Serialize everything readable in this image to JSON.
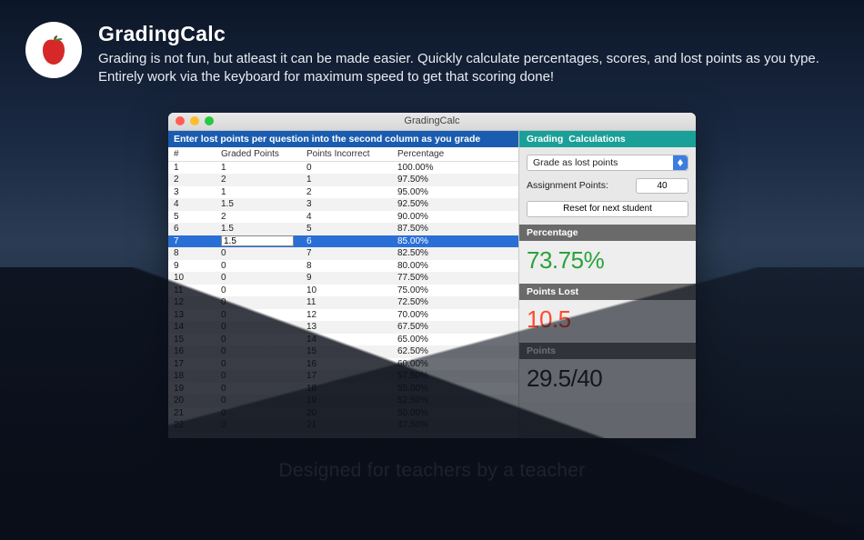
{
  "icon_name": "apple-icon",
  "app_name": "GradingCalc",
  "description": "Grading is not fun, but atleast it can be made easier. Quickly calculate percentages, scores, and lost points as you type. Entirely work via the keyboard for maximum speed to get that scoring done!",
  "tagline": "Designed for teachers by a teacher",
  "window": {
    "title": "GradingCalc",
    "left": {
      "banner": "Enter lost points per question into the second column as you grade",
      "columns": {
        "num": "#",
        "graded": "Graded Points",
        "incorrect": "Points Incorrect",
        "percent": "Percentage"
      },
      "selected_index": 6,
      "selected_input_value": "1.5",
      "rows": [
        {
          "n": "1",
          "g": "1",
          "i": "0",
          "p": "100.00%"
        },
        {
          "n": "2",
          "g": "2",
          "i": "1",
          "p": "97.50%"
        },
        {
          "n": "3",
          "g": "1",
          "i": "2",
          "p": "95.00%"
        },
        {
          "n": "4",
          "g": "1.5",
          "i": "3",
          "p": "92.50%"
        },
        {
          "n": "5",
          "g": "2",
          "i": "4",
          "p": "90.00%"
        },
        {
          "n": "6",
          "g": "1.5",
          "i": "5",
          "p": "87.50%"
        },
        {
          "n": "7",
          "g": "1.5",
          "i": "6",
          "p": "85.00%"
        },
        {
          "n": "8",
          "g": "0",
          "i": "7",
          "p": "82.50%"
        },
        {
          "n": "9",
          "g": "0",
          "i": "8",
          "p": "80.00%"
        },
        {
          "n": "10",
          "g": "0",
          "i": "9",
          "p": "77.50%"
        },
        {
          "n": "11",
          "g": "0",
          "i": "10",
          "p": "75.00%"
        },
        {
          "n": "12",
          "g": "0",
          "i": "11",
          "p": "72.50%"
        },
        {
          "n": "13",
          "g": "0",
          "i": "12",
          "p": "70.00%"
        },
        {
          "n": "14",
          "g": "0",
          "i": "13",
          "p": "67.50%"
        },
        {
          "n": "15",
          "g": "0",
          "i": "14",
          "p": "65.00%"
        },
        {
          "n": "16",
          "g": "0",
          "i": "15",
          "p": "62.50%"
        },
        {
          "n": "17",
          "g": "0",
          "i": "16",
          "p": "60.00%"
        },
        {
          "n": "18",
          "g": "0",
          "i": "17",
          "p": "57.50%"
        },
        {
          "n": "19",
          "g": "0",
          "i": "18",
          "p": "55.00%"
        },
        {
          "n": "20",
          "g": "0",
          "i": "19",
          "p": "52.50%"
        },
        {
          "n": "21",
          "g": "0",
          "i": "20",
          "p": "50.00%"
        },
        {
          "n": "22",
          "g": "0",
          "i": "21",
          "p": "47.50%"
        }
      ]
    },
    "right": {
      "header1": "Grading",
      "header2": "Calculations",
      "mode_select": "Grade as lost points",
      "assignment_label": "Assignment Points:",
      "assignment_value": "40",
      "reset_button": "Reset for next student",
      "metrics": {
        "percentage_label": "Percentage",
        "percentage_value": "73.75%",
        "lost_label": "Points Lost",
        "lost_value": "10.5",
        "points_label": "Points",
        "points_value": "29.5/40"
      }
    }
  }
}
